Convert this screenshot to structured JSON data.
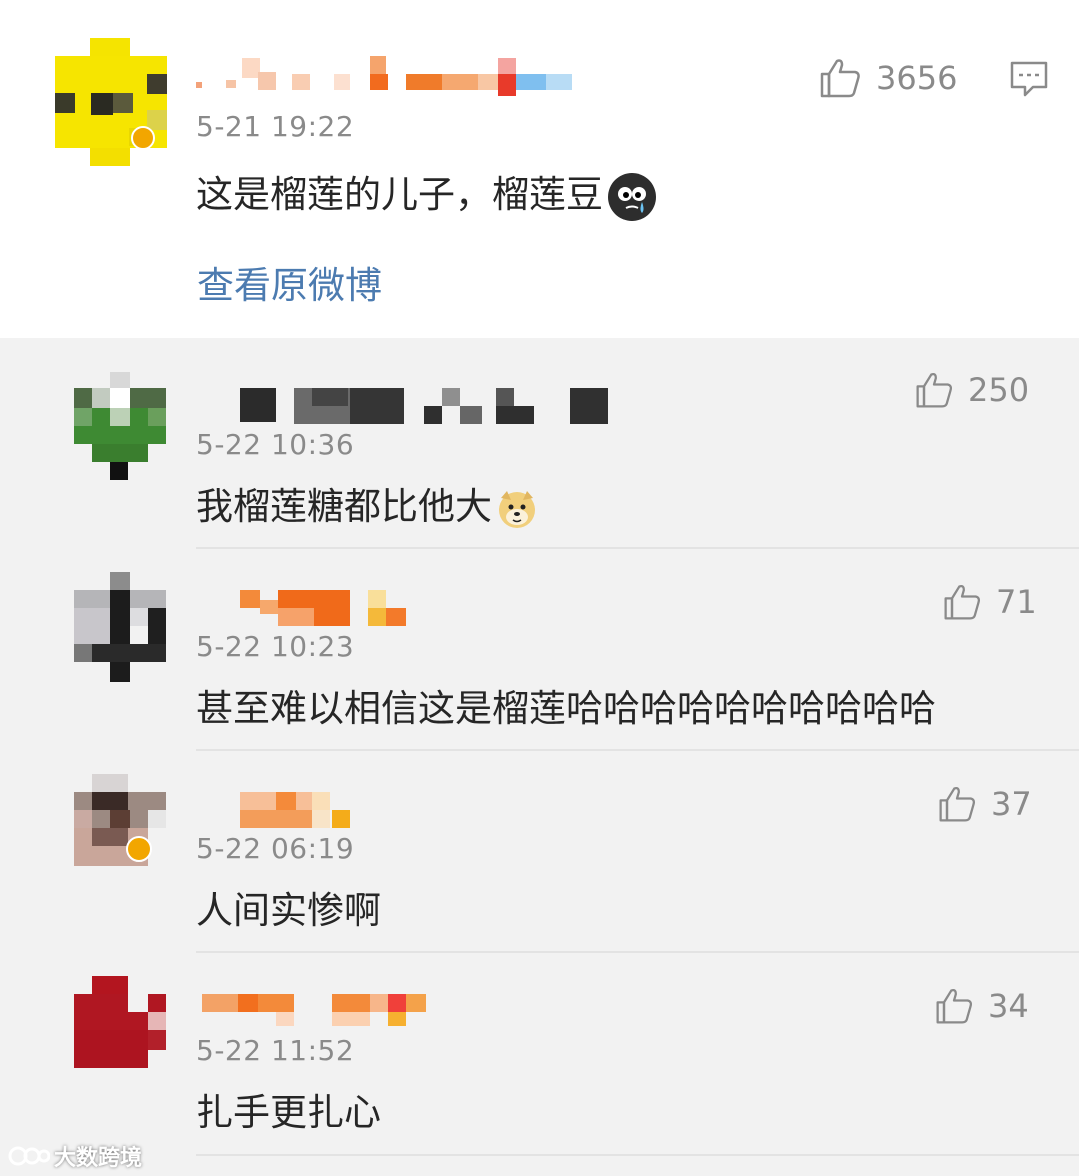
{
  "main_comment": {
    "timestamp": "5-21 19:22",
    "text": "这是榴莲的儿子，榴莲豆",
    "likes": "3656",
    "view_original": "查看原微博",
    "emoji": "crying-face-emoji",
    "icons": [
      "thumbs-up-icon",
      "comment-icon"
    ]
  },
  "replies": [
    {
      "timestamp": "5-22 10:36",
      "text": "我榴莲糖都比他大",
      "likes": "250",
      "emoji": "doge-emoji"
    },
    {
      "timestamp": "5-22 10:23",
      "text": "甚至难以相信这是榴莲哈哈哈哈哈哈哈哈哈哈",
      "likes": "71"
    },
    {
      "timestamp": "5-22 06:19",
      "text": "人间实惨啊",
      "likes": "37"
    },
    {
      "timestamp": "5-22 11:52",
      "text": "扎手更扎心",
      "likes": "34"
    }
  ],
  "watermark": {
    "text": "大数跨境"
  }
}
